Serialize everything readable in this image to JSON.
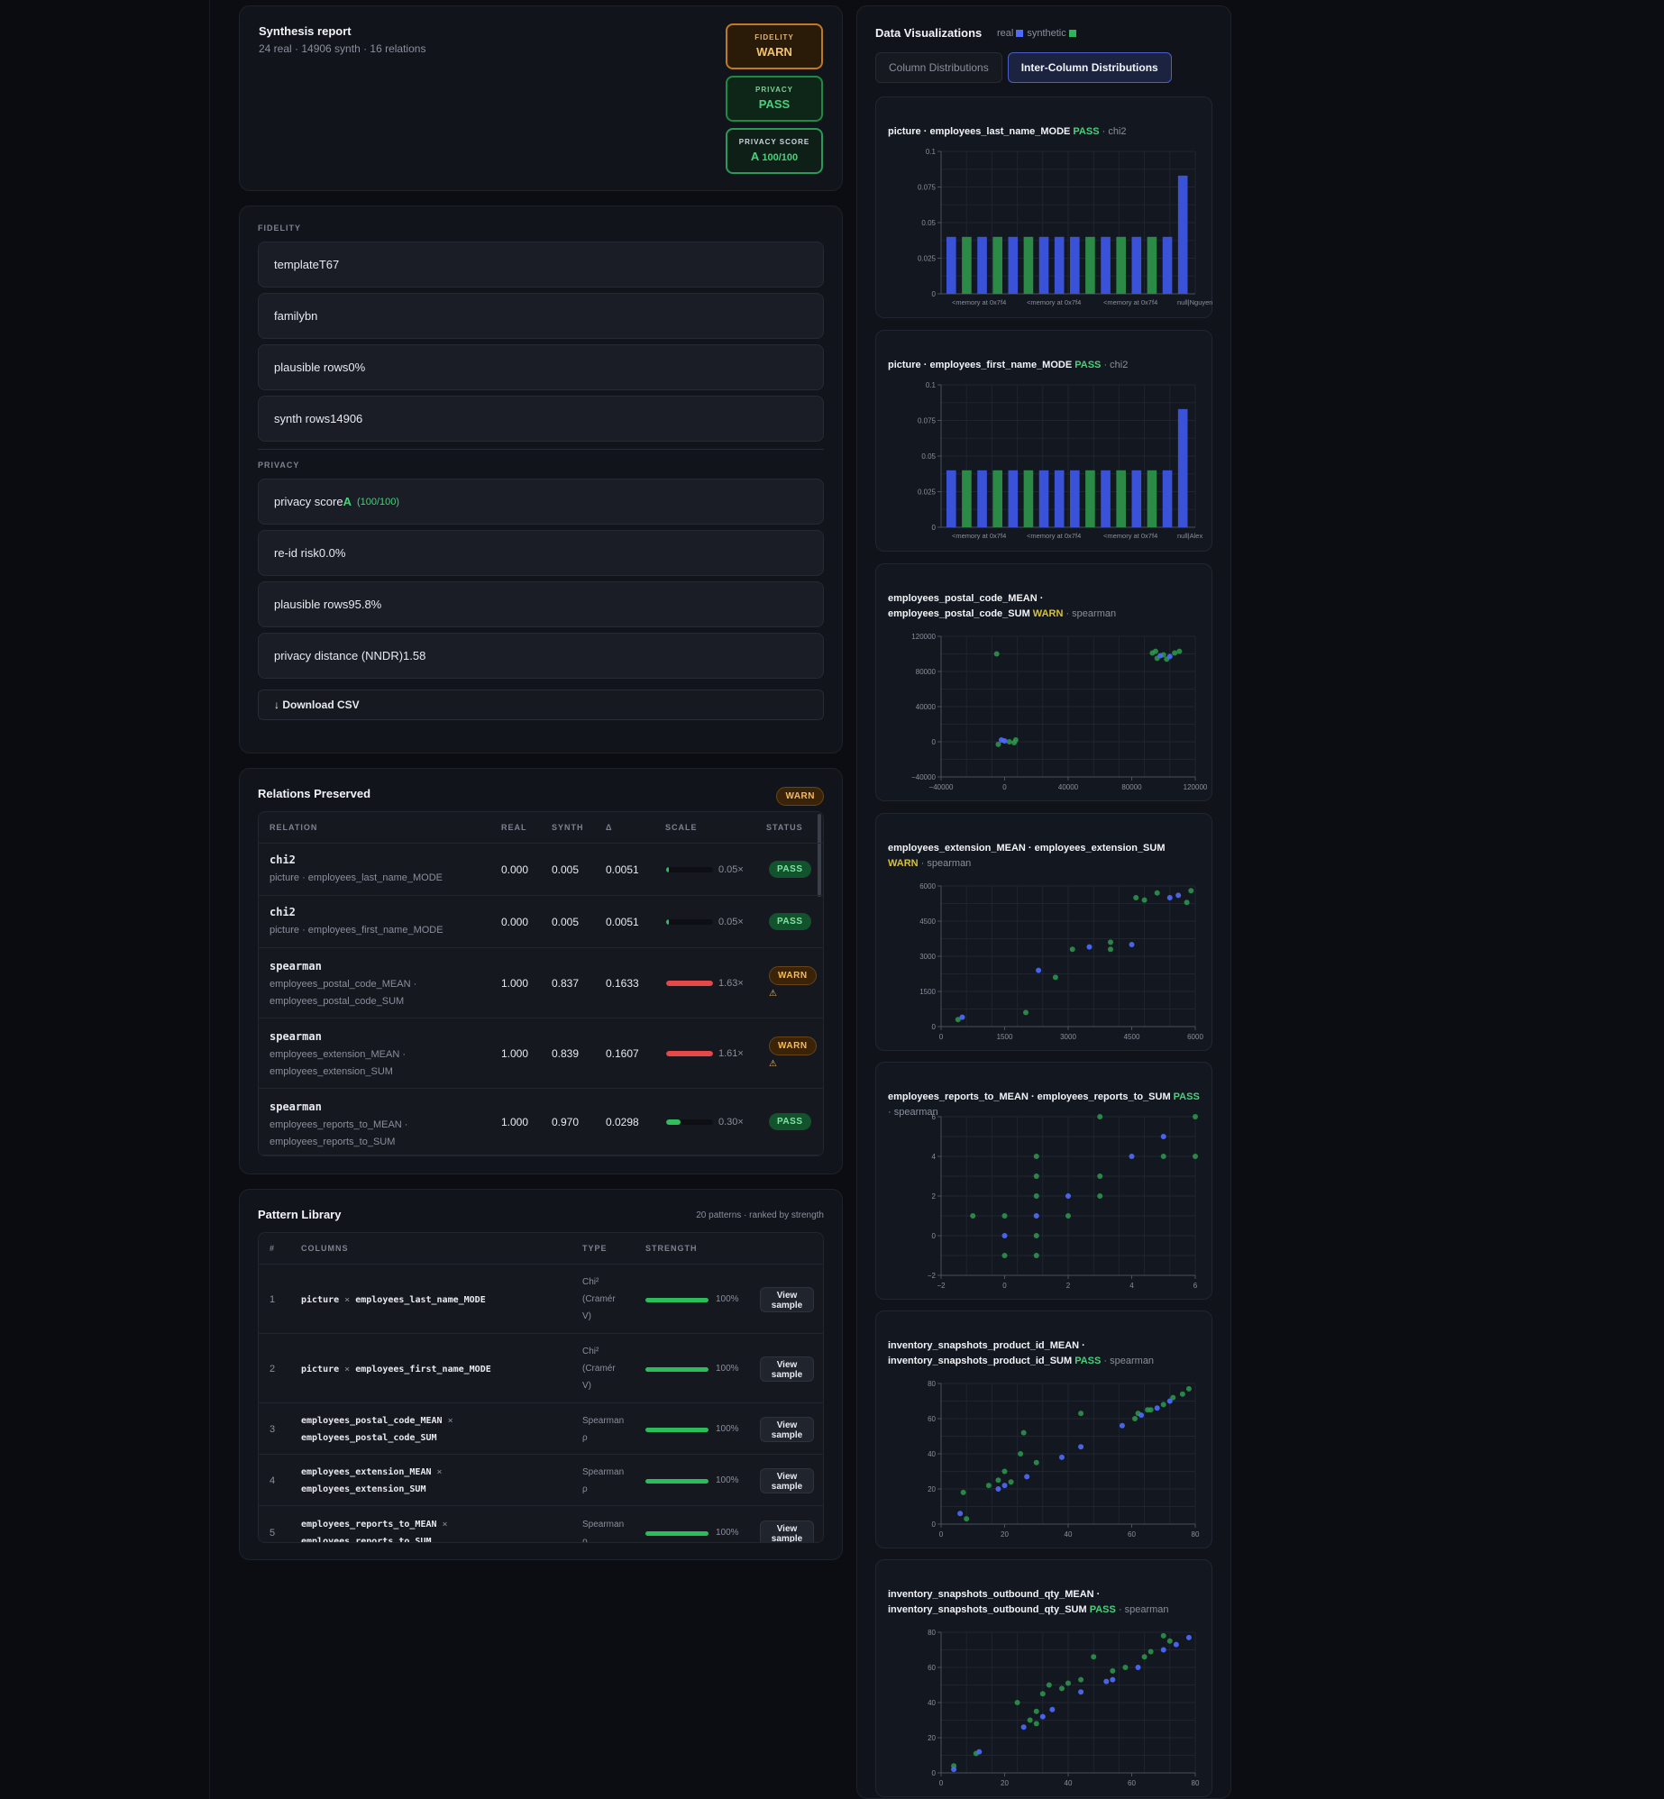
{
  "report": {
    "title": "Synthesis report",
    "subtitle": "24 real · 14906 synth · 16 relations",
    "badges": [
      {
        "label": "FIDELITY",
        "value": "WARN"
      },
      {
        "label": "PRIVACY",
        "value": "PASS"
      },
      {
        "label": "PRIVACY SCORE",
        "grade": "A",
        "value": "100/100"
      }
    ]
  },
  "fidelity": {
    "section_label": "FIDELITY",
    "rows": [
      "templateT67",
      "familybn",
      "plausible rows0%",
      "synth rows14906"
    ]
  },
  "privacy": {
    "section_label": "PRIVACY",
    "score_label": "privacy score",
    "score_grade": "A",
    "score_sub": "(100/100)",
    "rows": [
      "re-id risk0.0%",
      "plausible rows95.8%",
      "privacy distance (NNDR)1.58"
    ]
  },
  "download_label": "↓ Download CSV",
  "relations": {
    "title": "Relations Preserved",
    "badge": "WARN",
    "headers": [
      "RELATION",
      "REAL",
      "SYNTH",
      "Δ",
      "SCALE",
      "STATUS"
    ],
    "rows": [
      {
        "kind": "chi2",
        "cols": [
          "picture · employees_last_name_MODE"
        ],
        "real": "0.000",
        "synth": "0.005",
        "delta": "0.0051",
        "scale": "0.05×",
        "scale_frac": 0.05,
        "status": "PASS"
      },
      {
        "kind": "chi2",
        "cols": [
          "picture · employees_first_name_MODE"
        ],
        "real": "0.000",
        "synth": "0.005",
        "delta": "0.0051",
        "scale": "0.05×",
        "scale_frac": 0.05,
        "status": "PASS"
      },
      {
        "kind": "spearman",
        "cols": [
          "employees_postal_code_MEAN ·",
          "employees_postal_code_SUM"
        ],
        "real": "1.000",
        "synth": "0.837",
        "delta": "0.1633",
        "scale": "1.63×",
        "scale_frac": 1.0,
        "status": "WARN",
        "warn": "⚠"
      },
      {
        "kind": "spearman",
        "cols": [
          "employees_extension_MEAN ·",
          "employees_extension_SUM"
        ],
        "real": "1.000",
        "synth": "0.839",
        "delta": "0.1607",
        "scale": "1.61×",
        "scale_frac": 1.0,
        "status": "WARN",
        "warn": "⚠"
      },
      {
        "kind": "spearman",
        "cols": [
          "employees_reports_to_MEAN ·",
          "employees_reports_to_SUM"
        ],
        "real": "1.000",
        "synth": "0.970",
        "delta": "0.0298",
        "scale": "0.30×",
        "scale_frac": 0.3,
        "status": "PASS"
      }
    ]
  },
  "patterns": {
    "title": "Pattern Library",
    "subtitle": "20 patterns · ranked by strength",
    "headers": [
      "#",
      "COLUMNS",
      "TYPE",
      "STRENGTH"
    ],
    "view_label_1": "View",
    "view_label_2": "sample",
    "rows": [
      {
        "idx": "1",
        "a": "picture",
        "b": "employees_last_name_MODE",
        "type": [
          "Chi²",
          "(Cramér",
          "V)"
        ],
        "strength": "100%",
        "frac": 1.0
      },
      {
        "idx": "2",
        "a": "picture",
        "b": "employees_first_name_MODE",
        "type": [
          "Chi²",
          "(Cramér",
          "V)"
        ],
        "strength": "100%",
        "frac": 1.0
      },
      {
        "idx": "3",
        "a": "employees_postal_code_MEAN",
        "b": "employees_postal_code_SUM",
        "type": [
          "Spearman",
          "ρ"
        ],
        "strength": "100%",
        "frac": 1.0
      },
      {
        "idx": "4",
        "a": "employees_extension_MEAN",
        "b": "employees_extension_SUM",
        "type": [
          "Spearman",
          "ρ"
        ],
        "strength": "100%",
        "frac": 1.0
      },
      {
        "idx": "5",
        "a": "employees_reports_to_MEAN",
        "b": "employees_reports_to_SUM",
        "type": [
          "Spearman",
          "ρ"
        ],
        "strength": "100%",
        "frac": 1.0
      }
    ]
  },
  "viz": {
    "title": "Data Visualizations",
    "legend_real": "real",
    "legend_synth": "synthetic",
    "tabs": [
      "Column Distributions",
      "Inter-Column Distributions"
    ],
    "active_tab": 1
  },
  "colors": {
    "real": "#4f6bff",
    "synthetic": "#2f9a4e",
    "pass": "#4ad07a",
    "warn": "#d6c23a"
  },
  "chart_data": [
    {
      "type": "bar",
      "title": "picture · employees_last_name_MODE",
      "status": "PASS",
      "metric": "chi2",
      "categories": [
        "<memory at 0x7f4",
        "<memory at 0x7f4",
        "<memory at 0x7f4",
        "null|Nguyen"
      ],
      "yticks": [
        "0",
        "0.025",
        "0.05",
        "0.075",
        "0.1"
      ],
      "ylim": [
        0,
        0.1
      ],
      "bars": [
        [
          "real",
          0.04
        ],
        [
          "synthetic",
          0.04
        ],
        [
          "real",
          0.04
        ],
        [
          "synthetic",
          0.04
        ],
        [
          "real",
          0.04
        ],
        [
          "synthetic",
          0.04
        ],
        [
          "real",
          0.04
        ],
        [
          "real",
          0.04
        ],
        [
          "real",
          0.04
        ],
        [
          "synthetic",
          0.04
        ],
        [
          "real",
          0.04
        ],
        [
          "synthetic",
          0.04
        ],
        [
          "real",
          0.04
        ],
        [
          "synthetic",
          0.04
        ],
        [
          "real",
          0.04
        ],
        [
          "real",
          0.083
        ]
      ]
    },
    {
      "type": "bar",
      "title": "picture · employees_first_name_MODE",
      "status": "PASS",
      "metric": "chi2",
      "categories": [
        "<memory at 0x7f4",
        "<memory at 0x7f4",
        "<memory at 0x7f4",
        "null|Alex"
      ],
      "yticks": [
        "0",
        "0.025",
        "0.05",
        "0.075",
        "0.1"
      ],
      "ylim": [
        0,
        0.1
      ],
      "bars": [
        [
          "real",
          0.04
        ],
        [
          "synthetic",
          0.04
        ],
        [
          "real",
          0.04
        ],
        [
          "synthetic",
          0.04
        ],
        [
          "real",
          0.04
        ],
        [
          "synthetic",
          0.04
        ],
        [
          "real",
          0.04
        ],
        [
          "real",
          0.04
        ],
        [
          "real",
          0.04
        ],
        [
          "synthetic",
          0.04
        ],
        [
          "real",
          0.04
        ],
        [
          "synthetic",
          0.04
        ],
        [
          "real",
          0.04
        ],
        [
          "synthetic",
          0.04
        ],
        [
          "real",
          0.04
        ],
        [
          "real",
          0.083
        ]
      ]
    },
    {
      "type": "scatter",
      "title": [
        "employees_postal_code_MEAN ·",
        "employees_postal_code_SUM"
      ],
      "status": "WARN",
      "metric": "spearman",
      "xlim": [
        -40000,
        120000
      ],
      "ylim": [
        -40000,
        120000
      ],
      "xticks": [
        "−40000",
        "0",
        "40000",
        "80000",
        "120000"
      ],
      "yticks": [
        "−40000",
        "0",
        "40000",
        "80000",
        "120000"
      ],
      "real": [
        [
          0,
          1000
        ],
        [
          -2000,
          2000
        ],
        [
          98000,
          98000
        ],
        [
          104000,
          97000
        ]
      ],
      "synthetic": [
        [
          -4000,
          -3000
        ],
        [
          6000,
          -1000
        ],
        [
          7000,
          2000
        ],
        [
          3000,
          0
        ],
        [
          -5000,
          100000
        ],
        [
          93000,
          101000
        ],
        [
          96000,
          95000
        ],
        [
          100000,
          99000
        ],
        [
          107000,
          101000
        ],
        [
          110000,
          103000
        ],
        [
          102000,
          94000
        ],
        [
          95000,
          103000
        ]
      ]
    },
    {
      "type": "scatter",
      "title": [
        "employees_extension_MEAN · employees_extension_SUM"
      ],
      "status": "WARN",
      "metric": "spearman",
      "xlim": [
        0,
        6000
      ],
      "ylim": [
        0,
        6000
      ],
      "xticks": [
        "0",
        "1500",
        "3000",
        "4500",
        "6000"
      ],
      "yticks": [
        "0",
        "1500",
        "3000",
        "4500",
        "6000"
      ],
      "real": [
        [
          500,
          400
        ],
        [
          2300,
          2400
        ],
        [
          4500,
          3500
        ],
        [
          5400,
          5500
        ],
        [
          3500,
          3400
        ],
        [
          5600,
          5600
        ]
      ],
      "synthetic": [
        [
          400,
          300
        ],
        [
          2700,
          2100
        ],
        [
          4000,
          3300
        ],
        [
          5100,
          5700
        ],
        [
          5900,
          5800
        ],
        [
          5800,
          5300
        ],
        [
          2000,
          600
        ],
        [
          4800,
          5400
        ],
        [
          4600,
          5500
        ],
        [
          4000,
          3600
        ],
        [
          3100,
          3300
        ]
      ]
    },
    {
      "type": "scatter",
      "title": [
        "employees_reports_to_MEAN · employees_reports_to_SUM"
      ],
      "status": "PASS",
      "metric": "spearman",
      "xlim": [
        -2,
        6
      ],
      "ylim": [
        -2,
        6
      ],
      "xticks": [
        "−2",
        "0",
        "2",
        "4",
        "6"
      ],
      "yticks": [
        "−2",
        "0",
        "2",
        "4",
        "6"
      ],
      "real": [
        [
          0,
          0
        ],
        [
          1,
          1
        ],
        [
          2,
          2
        ],
        [
          4,
          4
        ],
        [
          5,
          5
        ]
      ],
      "synthetic": [
        [
          -1,
          1
        ],
        [
          0,
          1
        ],
        [
          0,
          -1
        ],
        [
          1,
          -1
        ],
        [
          1,
          0
        ],
        [
          1,
          2
        ],
        [
          1,
          3
        ],
        [
          1,
          4
        ],
        [
          2,
          1
        ],
        [
          3,
          2
        ],
        [
          3,
          3
        ],
        [
          3,
          6
        ],
        [
          5,
          4
        ],
        [
          6,
          4
        ],
        [
          6,
          6
        ]
      ]
    },
    {
      "type": "scatter",
      "title": [
        "inventory_snapshots_product_id_MEAN ·",
        "inventory_snapshots_product_id_SUM"
      ],
      "status": "PASS",
      "metric": "spearman",
      "xlim": [
        0,
        80
      ],
      "ylim": [
        0,
        80
      ],
      "xticks": [
        "0",
        "20",
        "40",
        "60",
        "80"
      ],
      "yticks": [
        "0",
        "20",
        "40",
        "60",
        "80"
      ],
      "real": [
        [
          6,
          6
        ],
        [
          18,
          20
        ],
        [
          20,
          22
        ],
        [
          27,
          27
        ],
        [
          38,
          38
        ],
        [
          44,
          44
        ],
        [
          57,
          56
        ],
        [
          63,
          62
        ],
        [
          68,
          66
        ],
        [
          72,
          70
        ]
      ],
      "synthetic": [
        [
          8,
          3
        ],
        [
          7,
          18
        ],
        [
          15,
          22
        ],
        [
          18,
          25
        ],
        [
          20,
          30
        ],
        [
          25,
          40
        ],
        [
          26,
          52
        ],
        [
          22,
          24
        ],
        [
          30,
          35
        ],
        [
          44,
          63
        ],
        [
          61,
          60
        ],
        [
          62,
          63
        ],
        [
          65,
          65
        ],
        [
          73,
          72
        ],
        [
          76,
          74
        ],
        [
          78,
          77
        ],
        [
          70,
          68
        ],
        [
          66,
          65
        ]
      ]
    },
    {
      "type": "scatter",
      "title": [
        "inventory_snapshots_outbound_qty_MEAN ·",
        "inventory_snapshots_outbound_qty_SUM"
      ],
      "status": "PASS",
      "metric": "spearman",
      "xlim": [
        0,
        80
      ],
      "ylim": [
        0,
        80
      ],
      "xticks": [
        "0",
        "20",
        "40",
        "60",
        "80"
      ],
      "yticks": [
        "0",
        "20",
        "40",
        "60",
        "80"
      ],
      "real": [
        [
          4,
          2
        ],
        [
          12,
          12
        ],
        [
          26,
          26
        ],
        [
          32,
          32
        ],
        [
          35,
          36
        ],
        [
          44,
          46
        ],
        [
          52,
          52
        ],
        [
          54,
          53
        ],
        [
          62,
          60
        ],
        [
          70,
          70
        ],
        [
          74,
          73
        ],
        [
          78,
          77
        ]
      ],
      "synthetic": [
        [
          4,
          4
        ],
        [
          11,
          11
        ],
        [
          28,
          30
        ],
        [
          30,
          35
        ],
        [
          32,
          45
        ],
        [
          34,
          50
        ],
        [
          38,
          48
        ],
        [
          40,
          51
        ],
        [
          44,
          53
        ],
        [
          48,
          66
        ],
        [
          54,
          58
        ],
        [
          58,
          60
        ],
        [
          64,
          66
        ],
        [
          70,
          78
        ],
        [
          72,
          75
        ],
        [
          66,
          69
        ],
        [
          30,
          28
        ],
        [
          24,
          40
        ]
      ]
    }
  ]
}
